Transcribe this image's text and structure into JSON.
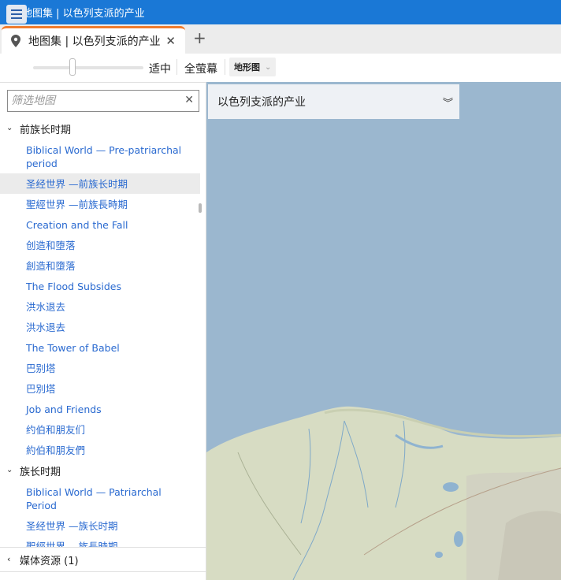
{
  "window": {
    "title": "地图集 | 以色列支派的产业"
  },
  "tabs": {
    "active_label": "地图集 | 以色列支派的产业",
    "close_symbol": "✕",
    "new_tab_symbol": "+"
  },
  "toolbar": {
    "fit_label": "适中",
    "fullscreen_label": "全萤幕",
    "maptype_label": "地形图",
    "zoom_level": 0.35
  },
  "sidebar": {
    "filter_placeholder": "筛选地图",
    "clear_symbol": "✕",
    "groups": [
      {
        "label": "前族长时期",
        "items": [
          "Biblical World — Pre-patriarchal period",
          "圣经世界 —前族长时期",
          "聖經世界 —前族長時期",
          "Creation and the Fall",
          "创造和堕落",
          "創造和墮落",
          "The Flood Subsides",
          "洪水退去",
          "洪水退去",
          "The Tower of Babel",
          "巴别塔",
          "巴別塔",
          "Job and Friends",
          "约伯和朋友们",
          "約伯和朋友們"
        ]
      },
      {
        "label": "族长时期",
        "items": [
          "Biblical World — Patriarchal Period",
          "圣经世界 —族长时期",
          "聖經世界 —族長時期"
        ]
      }
    ],
    "media_label": "媒体资源 (1)"
  },
  "map": {
    "selected_map": "以色列支派的产业",
    "sea_color": "#9bb7cf",
    "land_color": "#d7dcc3"
  }
}
